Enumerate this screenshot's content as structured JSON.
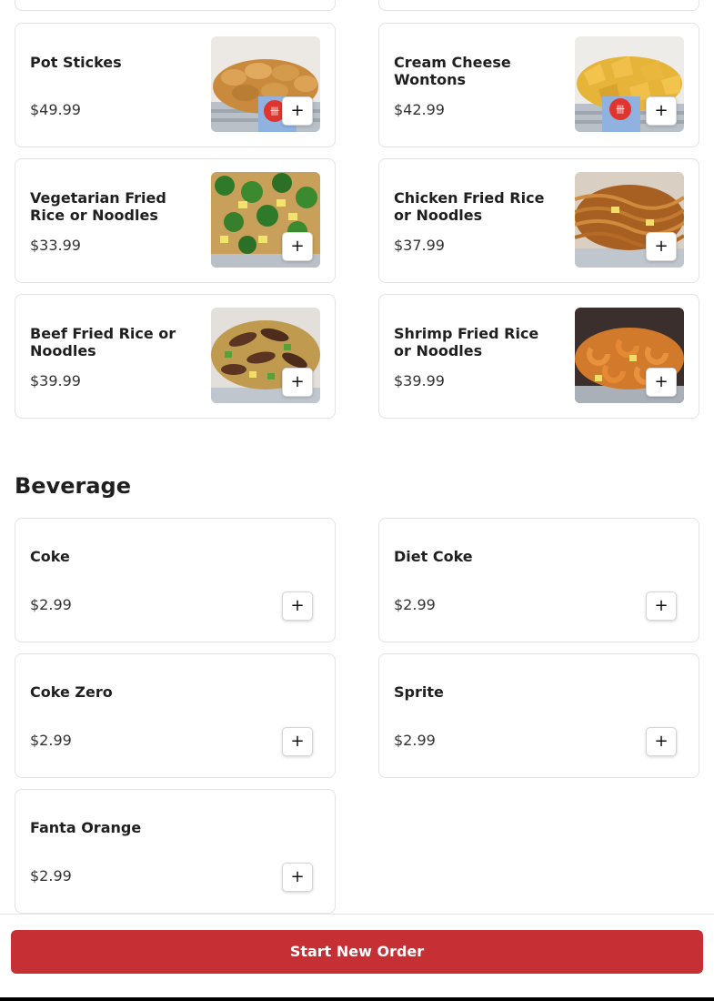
{
  "menu": {
    "items": [
      {
        "name": "Pot Stickes",
        "price": "$49.99",
        "image": "pot-stickers-tray-photo"
      },
      {
        "name": "Cream Cheese Wontons",
        "price": "$42.99",
        "image": "cream-cheese-wontons-tray-photo"
      },
      {
        "name": "Vegetarian Fried Rice or Noodles",
        "price": "$33.99",
        "image": "vegetarian-fried-rice-photo"
      },
      {
        "name": "Chicken Fried Rice or Noodles",
        "price": "$37.99",
        "image": "chicken-noodles-photo"
      },
      {
        "name": "Beef Fried Rice or Noodles",
        "price": "$39.99",
        "image": "beef-fried-rice-photo"
      },
      {
        "name": "Shrimp Fried Rice or Noodles",
        "price": "$39.99",
        "image": "shrimp-fried-rice-photo"
      }
    ]
  },
  "beverage": {
    "title": "Beverage",
    "items": [
      {
        "name": "Coke",
        "price": "$2.99"
      },
      {
        "name": "Diet Coke",
        "price": "$2.99"
      },
      {
        "name": "Coke Zero",
        "price": "$2.99"
      },
      {
        "name": "Sprite",
        "price": "$2.99"
      },
      {
        "name": "Fanta Orange",
        "price": "$2.99"
      }
    ]
  },
  "add_button": {
    "label": "+",
    "icon": "plus-icon"
  },
  "footer": {
    "start_order_label": "Start New Order"
  },
  "colors": {
    "accent": "#c62f33",
    "card_border": "#e3e3e3",
    "text": "#1f1f1f"
  }
}
